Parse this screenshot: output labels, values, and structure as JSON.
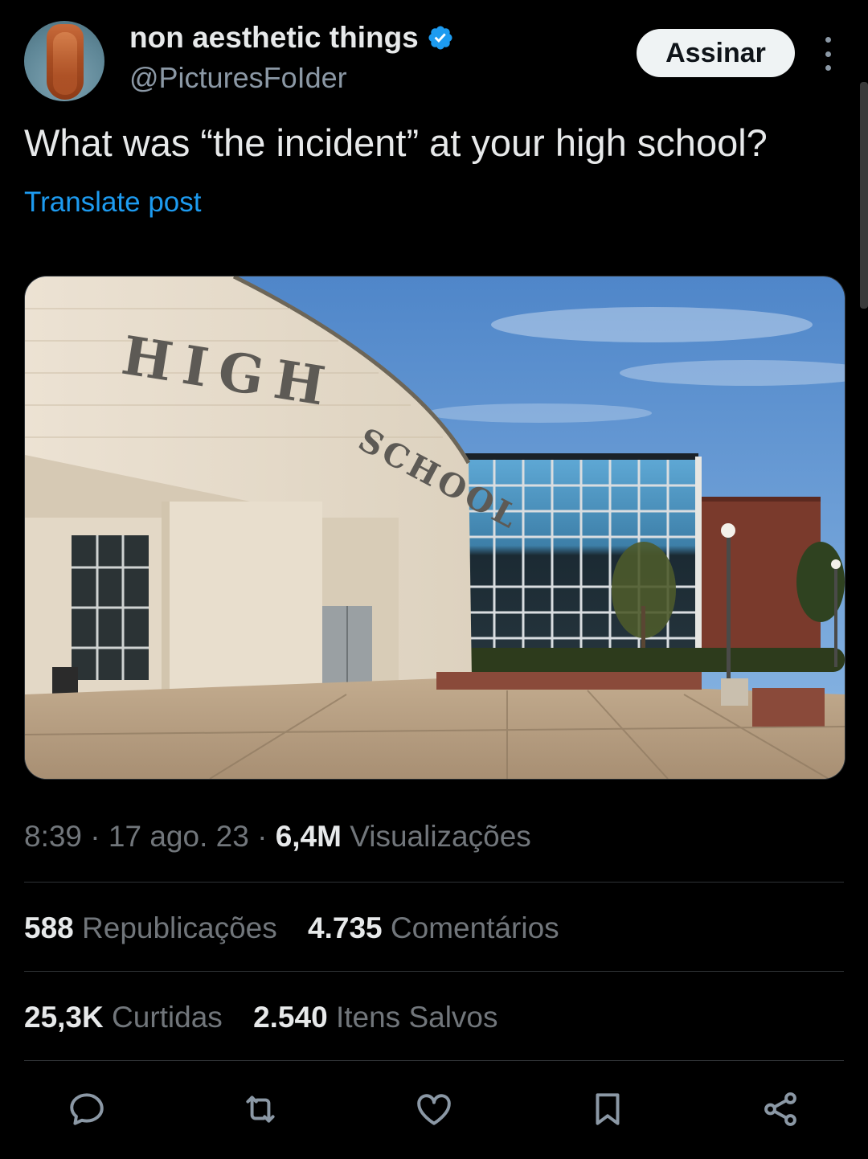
{
  "author": {
    "name": "non aesthetic things",
    "handle": "@PicturesFoIder",
    "verified": true,
    "subscribe_label": "Assinar"
  },
  "tweet": {
    "text": "What was “the incident” at your high school?",
    "translate_label": "Translate post",
    "image_sign_text": [
      "HIGH",
      "SCHOOL"
    ]
  },
  "meta": {
    "time": "8:39",
    "separator": "·",
    "date": "17 ago. 23",
    "views_count": "6,4M",
    "views_label": "Visualizações"
  },
  "stats": {
    "reposts_count": "588",
    "reposts_label": "Republicações",
    "comments_count": "4.735",
    "comments_label": "Comentários",
    "likes_count": "25,3K",
    "likes_label": "Curtidas",
    "saves_count": "2.540",
    "saves_label": "Itens Salvos"
  },
  "actions": [
    "reply-icon",
    "repost-icon",
    "like-icon",
    "bookmark-icon",
    "share-icon"
  ],
  "colors": {
    "background": "#000000",
    "text": "#e7e9ea",
    "secondary": "#71767b",
    "link": "#1d9bf0",
    "verified": "#1d9bf0"
  }
}
